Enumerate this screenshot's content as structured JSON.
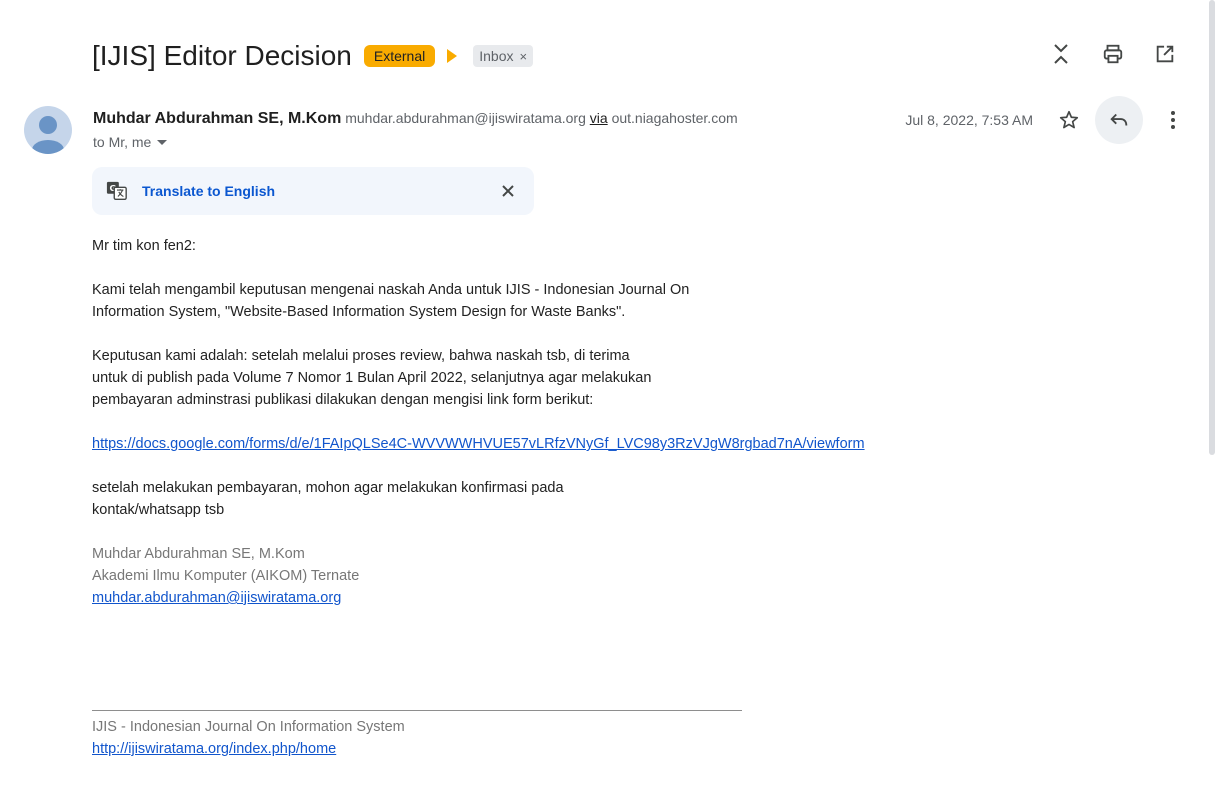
{
  "subject": "[IJIS] Editor Decision",
  "labels": {
    "external": "External",
    "inbox": "Inbox",
    "remove_symbol": "×"
  },
  "icons": {
    "collapse": "collapse-icon",
    "print": "print-icon",
    "open_new_window": "open-in-new-icon",
    "star": "star-icon",
    "reply": "reply-icon",
    "more": "more-vert-icon",
    "translate": "translate-icon",
    "close": "close-icon"
  },
  "colors": {
    "external_badge": "#f9ab00",
    "link": "#1155cc",
    "translate_link": "#0b57d0",
    "translate_bar_bg": "#f2f6fc"
  },
  "sender": {
    "name": "Muhdar Abdurahman SE, M.Kom",
    "email": "muhdar.abdurahman@ijiswiratama.org",
    "via_label": "via",
    "via_host": "out.niagahoster.com",
    "recipients": "to Mr, me"
  },
  "date": "Jul 8, 2022, 7:53 AM",
  "translate": {
    "label": "Translate to English"
  },
  "body": {
    "greeting": "Mr tim kon fen2:",
    "para1": "Kami telah mengambil keputusan mengenai naskah Anda untuk IJIS - Indonesian Journal On Information System, \"Website-Based Information System Design for Waste Banks\".",
    "para2": "Keputusan kami adalah: setelah melalui proses review, bahwa naskah tsb, di terima untuk di publish pada Volume 7 Nomor 1 Bulan April 2022, selanjutnya agar melakukan pembayaran adminstrasi publikasi dilakukan dengan mengisi link form berikut:",
    "form_link": "https://docs.google.com/forms/d/e/1FAIpQLSe4C-WVVWWHVUE57vLRfzVNyGf_LVC98y3RzVJgW8rgbad7nA/viewform",
    "para3": "setelah melakukan pembayaran, mohon agar melakukan konfirmasi pada kontak/whatsapp tsb"
  },
  "signature": {
    "name": "Muhdar Abdurahman SE, M.Kom",
    "org": "Akademi Ilmu Komputer (AIKOM) Ternate",
    "email": "muhdar.abdurahman@ijiswiratama.org"
  },
  "footer": {
    "journal": "IJIS - Indonesian Journal On Information System",
    "url": "http://ijiswiratama.org/index.php/home"
  }
}
